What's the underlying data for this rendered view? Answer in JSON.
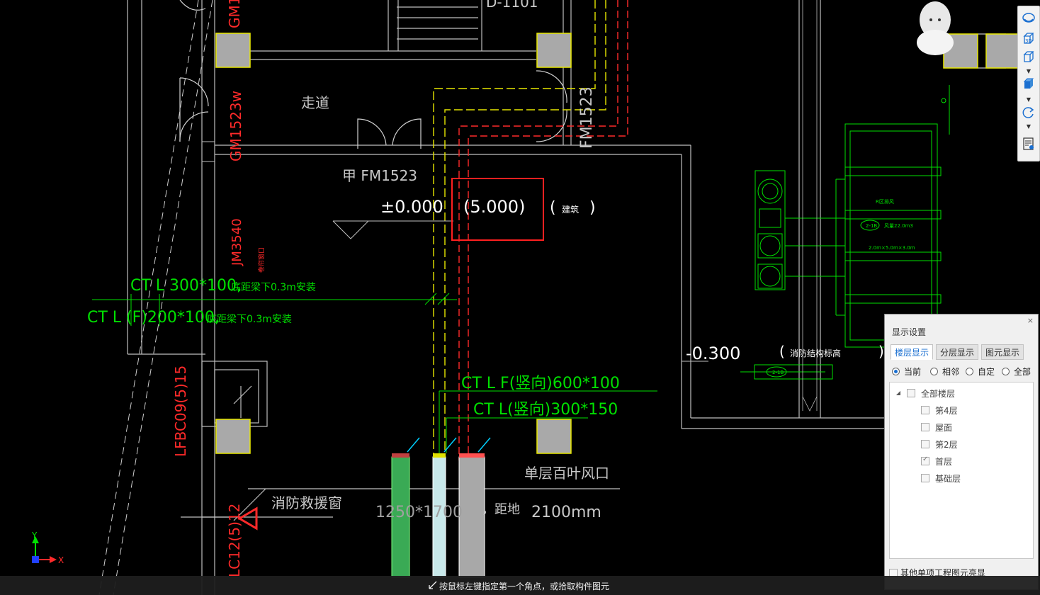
{
  "drawing": {
    "room_label": "走道",
    "door_top_right": "FM1523",
    "door_left_upper": "GM1523w",
    "door_left_top": "GM1",
    "door_top_center": "D-1101",
    "door_jia": "甲 FM1523",
    "elev_zero": "±0.000",
    "elev_paren": "(5.000)",
    "elev_note_open": "(",
    "elev_note_text": "建筑",
    "elev_note_close": ")",
    "window_jm": "JM3540",
    "window_jm_note": "卷帘窗口",
    "ct_line1_code": "CT L 300*100,",
    "ct_line1_note": "底距梁下0.3m安装",
    "ct_line2_code": "CT L (F)200*100,",
    "ct_line2_note": "底距梁下0.3m安装",
    "lfbc": "LFBC09(5)15",
    "lc": "LC12(5)12",
    "elev_neg": "-0.300",
    "elev_neg_note_open": "(",
    "elev_neg_note_text": "消防结构标高",
    "elev_neg_note_close": ")",
    "ct_f_code": "CT L F(竖向)600*100",
    "ct_v_code": "CT L(竖向)300*150",
    "louver": "单层百叶风口",
    "rescue_window": "消防救援窗",
    "size_window": "1250*1700",
    "to_floor": "，距地",
    "height_mm": "2100mm",
    "equip_label1": "R区排风",
    "equip_label2": "2-1B",
    "equip_label3": "风量22.0m3",
    "equip_label4": "2.0m×5.0m×3.0m",
    "equip_label5": "2-1B",
    "axis_y": "Y",
    "axis_x": "X"
  },
  "toolbar": {
    "items": [
      "orbit-icon",
      "3d-view-icon",
      "box-view-icon",
      "solid-view-icon",
      "rotate-icon",
      "properties-icon"
    ]
  },
  "panel": {
    "title": "显示设置",
    "close": "×",
    "tabs": [
      "楼层显示",
      "分层显示",
      "图元显示"
    ],
    "active_tab": 0,
    "radios": [
      "当前",
      "相邻",
      "自定",
      "全部"
    ],
    "selected_radio": 0,
    "tree": {
      "root": "全部楼层",
      "floors": [
        {
          "label": "第4层",
          "checked": false
        },
        {
          "label": "屋面",
          "checked": false
        },
        {
          "label": "第2层",
          "checked": false
        },
        {
          "label": "首层",
          "checked": true
        },
        {
          "label": "基础层",
          "checked": false
        }
      ]
    },
    "footer_check": "其他单项工程图元亮显"
  },
  "status": {
    "message": "按鼠标左键指定第一个角点，或拾取构件图元"
  },
  "colors": {
    "wall": "#bfbfbf",
    "column_fill": "#a9a9a9",
    "column_border": "#e8e800",
    "green": "#00e000",
    "red": "#ff2a2a",
    "yellow": "#e6e600",
    "cyan": "#00c8ff",
    "selection": "#ff2020"
  }
}
